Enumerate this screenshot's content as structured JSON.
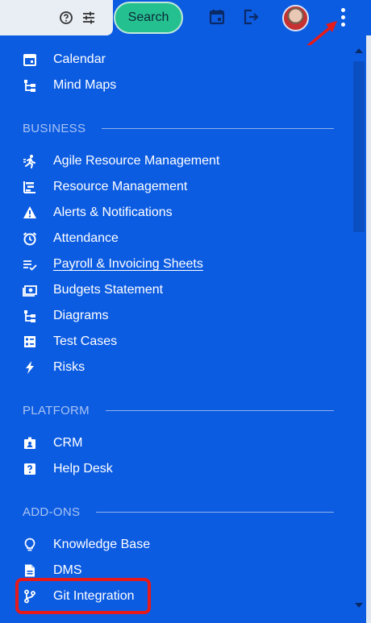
{
  "topbar": {
    "help_icon": "help-circle-icon",
    "filter_icon": "sliders-icon",
    "search_label": "Search",
    "calendar_icon": "calendar-icon",
    "export_icon": "export-icon",
    "avatar_icon": "user-avatar",
    "menu_icon": "more-vertical-icon"
  },
  "menu": {
    "items_top": [
      {
        "label": "Calendar",
        "icon": "calendar-icon"
      },
      {
        "label": "Mind Maps",
        "icon": "tree-icon"
      }
    ],
    "business_title": "BUSINESS",
    "business": [
      {
        "label": "Agile Resource Management",
        "icon": "running-icon"
      },
      {
        "label": "Resource Management",
        "icon": "gantt-icon"
      },
      {
        "label": "Alerts & Notifications",
        "icon": "warning-icon"
      },
      {
        "label": "Attendance",
        "icon": "alarm-clock-icon"
      },
      {
        "label": "Payroll & Invoicing Sheets",
        "icon": "checklist-icon"
      },
      {
        "label": "Budgets Statement",
        "icon": "cash-icon"
      },
      {
        "label": "Diagrams",
        "icon": "tree-icon"
      },
      {
        "label": "Test Cases",
        "icon": "checkbox-list-icon"
      },
      {
        "label": "Risks",
        "icon": "lightning-icon"
      }
    ],
    "platform_title": "PLATFORM",
    "platform": [
      {
        "label": "CRM",
        "icon": "contact-badge-icon"
      },
      {
        "label": "Help Desk",
        "icon": "question-box-icon"
      }
    ],
    "addons_title": "ADD-ONS",
    "addons": [
      {
        "label": "Knowledge Base",
        "icon": "lightbulb-icon"
      },
      {
        "label": "DMS",
        "icon": "document-icon"
      },
      {
        "label": "Git Integration",
        "icon": "git-branch-icon"
      }
    ]
  },
  "colors": {
    "menu_bg": "#0c5ce2",
    "search_bg": "#25c08f",
    "highlight": "#e61a1a",
    "section_title": "#a9c3f2"
  }
}
